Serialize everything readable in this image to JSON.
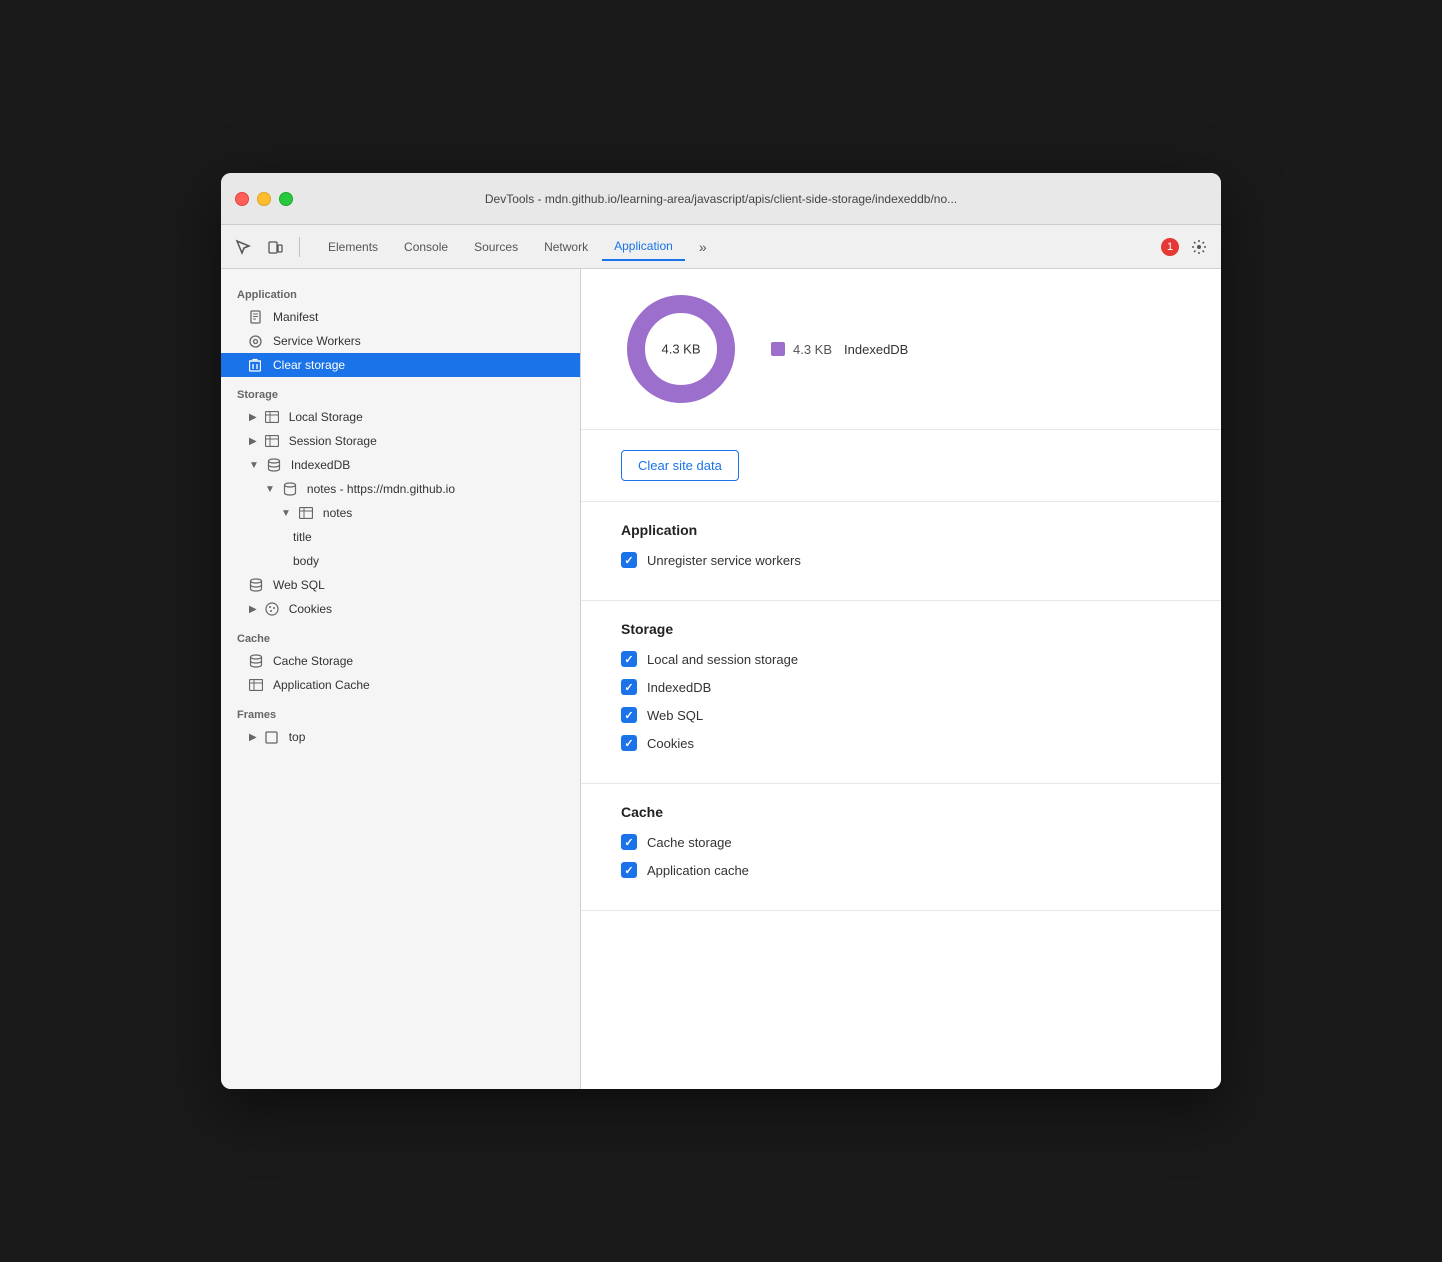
{
  "window": {
    "title": "DevTools - mdn.github.io/learning-area/javascript/apis/client-side-storage/indexeddb/no..."
  },
  "toolbar": {
    "tabs": [
      "Elements",
      "Console",
      "Sources",
      "Network",
      "Application"
    ],
    "active_tab": "Application",
    "error_count": "1"
  },
  "sidebar": {
    "section_application": "Application",
    "manifest_label": "Manifest",
    "service_workers_label": "Service Workers",
    "clear_storage_label": "Clear storage",
    "section_storage": "Storage",
    "local_storage_label": "Local Storage",
    "session_storage_label": "Session Storage",
    "indexed_db_label": "IndexedDB",
    "notes_db_label": "notes - https://mdn.github.io",
    "notes_store_label": "notes",
    "title_label": "title",
    "body_label": "body",
    "web_sql_label": "Web SQL",
    "cookies_label": "Cookies",
    "section_cache": "Cache",
    "cache_storage_label": "Cache Storage",
    "app_cache_label": "Application Cache",
    "section_frames": "Frames",
    "top_label": "top"
  },
  "chart": {
    "center_label": "4.3 KB",
    "legend_value": "4.3 KB",
    "legend_label": "IndexedDB",
    "legend_color": "#9c6fcd"
  },
  "panel": {
    "clear_btn_label": "Clear site data",
    "section_application_title": "Application",
    "unregister_label": "Unregister service workers",
    "section_storage_title": "Storage",
    "local_session_label": "Local and session storage",
    "indexed_db_label": "IndexedDB",
    "web_sql_label": "Web SQL",
    "cookies_label": "Cookies",
    "section_cache_title": "Cache",
    "cache_storage_label": "Cache storage",
    "app_cache_label": "Application cache"
  }
}
